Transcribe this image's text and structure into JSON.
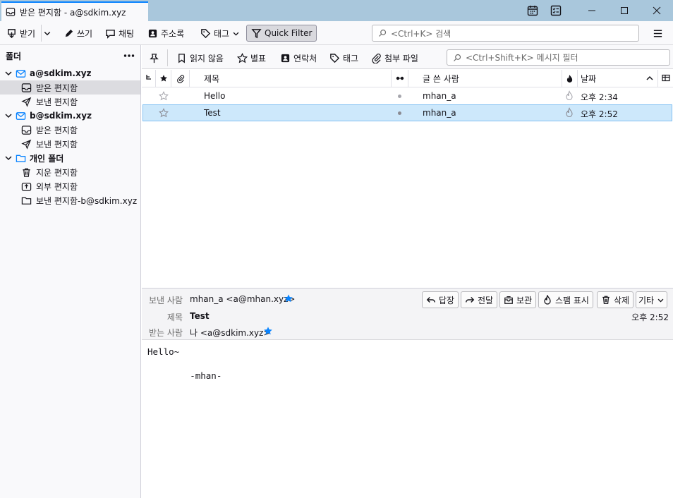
{
  "window": {
    "tab_title": "받은 편지함 - a@sdkim.xyz"
  },
  "toolbar": {
    "get_messages": "받기",
    "write": "쓰기",
    "chat": "채팅",
    "address_book": "주소록",
    "tag": "태그",
    "quick_filter": "Quick Filter",
    "search_placeholder": "<Ctrl+K> 검색"
  },
  "sidebar": {
    "header": "폴더",
    "accounts": [
      {
        "name": "a@sdkim.xyz",
        "folders": [
          "받은 편지함",
          "보낸 편지함"
        ]
      },
      {
        "name": "b@sdkim.xyz",
        "folders": [
          "받은 편지함",
          "보낸 편지함"
        ]
      },
      {
        "name": "개인 폴더",
        "folders": [
          "지운 편지함",
          "외부 편지함",
          "보낸 편지함-b@sdkim.xyz"
        ]
      }
    ]
  },
  "quick_filter": {
    "unread": "읽지 않음",
    "starred": "별표",
    "contacts": "연락처",
    "tags": "태그",
    "attachment": "첨부 파일",
    "filter_placeholder": "<Ctrl+Shift+K> 메시지 필터"
  },
  "columns": {
    "subject": "제목",
    "sender": "글 쓴 사람",
    "date": "날짜"
  },
  "messages": [
    {
      "subject": "Hello",
      "sender": "mhan_a",
      "date": "오후 2:34",
      "selected": false
    },
    {
      "subject": "Test",
      "sender": "mhan_a",
      "date": "오후 2:52",
      "selected": true
    }
  ],
  "message_header": {
    "from_label": "보낸 사람",
    "from_value": "mhan_a <a@mhan.xyz>",
    "subject_label": "제목",
    "subject_value": "Test",
    "to_label": "받는 사람",
    "to_value": "나 <a@sdkim.xyz>",
    "date": "오후 2:52",
    "buttons": {
      "reply": "답장",
      "forward": "전달",
      "archive": "보관",
      "junk": "스팸 표시",
      "delete": "삭제",
      "more": "기타"
    }
  },
  "message_body": {
    "line1": "Hello~",
    "line2": "",
    "line3": "        -mhan-"
  },
  "colors": {
    "accent": "#0a84ff",
    "titlebar": "#a9c7dc",
    "selected_row": "#cde8fb"
  }
}
